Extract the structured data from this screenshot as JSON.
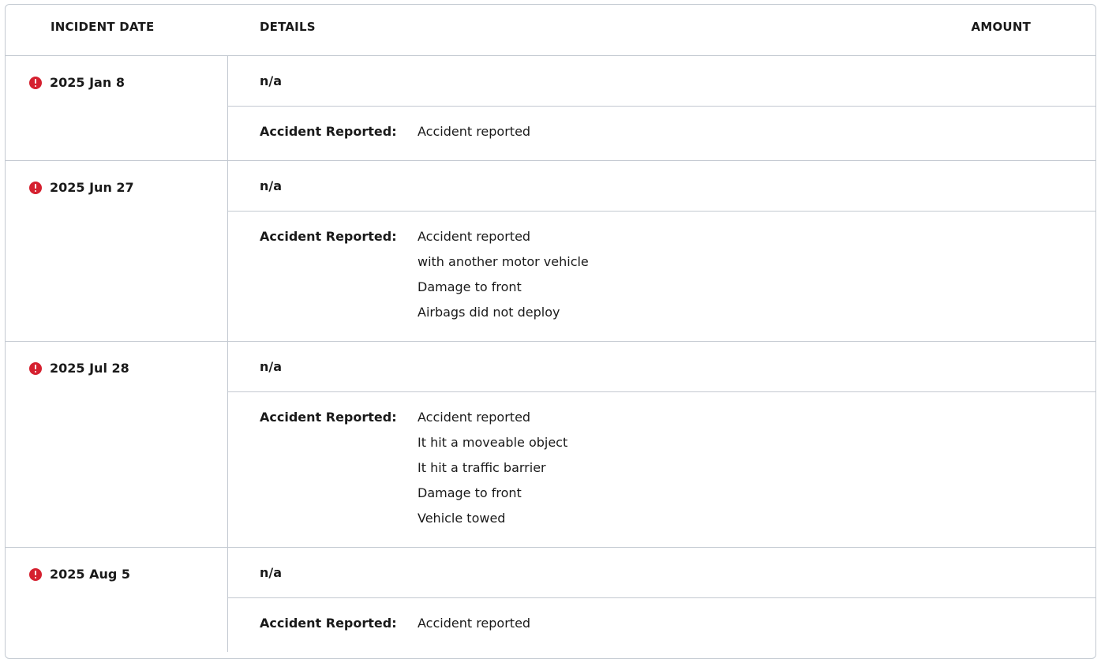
{
  "header": {
    "incident_date": "INCIDENT DATE",
    "details": "DETAILS",
    "amount": "AMOUNT"
  },
  "incidents": [
    {
      "date": "2025 Jan 8",
      "details": "n/a",
      "label": "Accident Reported:",
      "lines": [
        "Accident reported"
      ]
    },
    {
      "date": "2025 Jun 27",
      "details": "n/a",
      "label": "Accident Reported:",
      "lines": [
        "Accident reported",
        "with another motor vehicle",
        "Damage to front",
        "Airbags did not deploy"
      ]
    },
    {
      "date": "2025 Jul 28",
      "details": "n/a",
      "label": "Accident Reported:",
      "lines": [
        "Accident reported",
        "It hit a moveable object",
        "It hit a traffic barrier",
        "Damage to front",
        "Vehicle towed"
      ]
    },
    {
      "date": "2025 Aug 5",
      "details": "n/a",
      "label": "Accident Reported:",
      "lines": [
        "Accident reported"
      ]
    }
  ],
  "icons": {
    "alert": "alert-icon"
  },
  "colors": {
    "alert": "#d5202f",
    "border": "#c3c9d1"
  }
}
